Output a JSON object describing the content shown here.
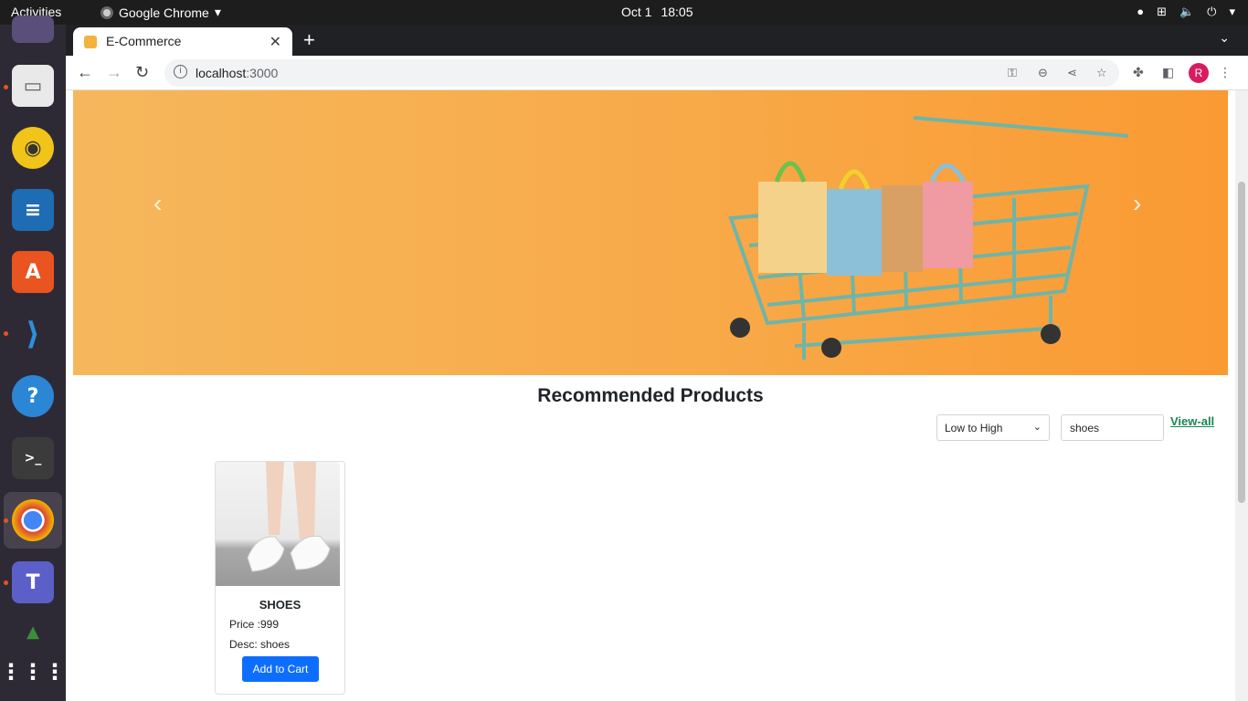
{
  "topbar": {
    "activities": "Activities",
    "app_name": "Google Chrome",
    "date": "Oct 1",
    "time": "18:05"
  },
  "dock": {
    "items": [
      "files-icon",
      "rhythmbox-icon",
      "writer-icon",
      "software-center-icon",
      "vscode-icon",
      "help-icon",
      "terminal-icon",
      "chrome-icon",
      "teams-icon",
      "trash-icon",
      "apps-grid-icon"
    ]
  },
  "browser": {
    "tab_title": "E-Commerce",
    "url_host": "localhost",
    "url_port": ":3000",
    "profile_initial": "R"
  },
  "page": {
    "section_title": "Recommended Products",
    "sort_select": "Low to High",
    "search_value": "shoes",
    "view_all": "View-all",
    "product": {
      "name": "SHOES",
      "price": "Price :999",
      "desc": "Desc: shoes",
      "button": "Add to Cart"
    }
  },
  "colors": {
    "accent_button": "#0d6efd",
    "link_green": "#198754",
    "carousel_orange": "#f8a948"
  }
}
